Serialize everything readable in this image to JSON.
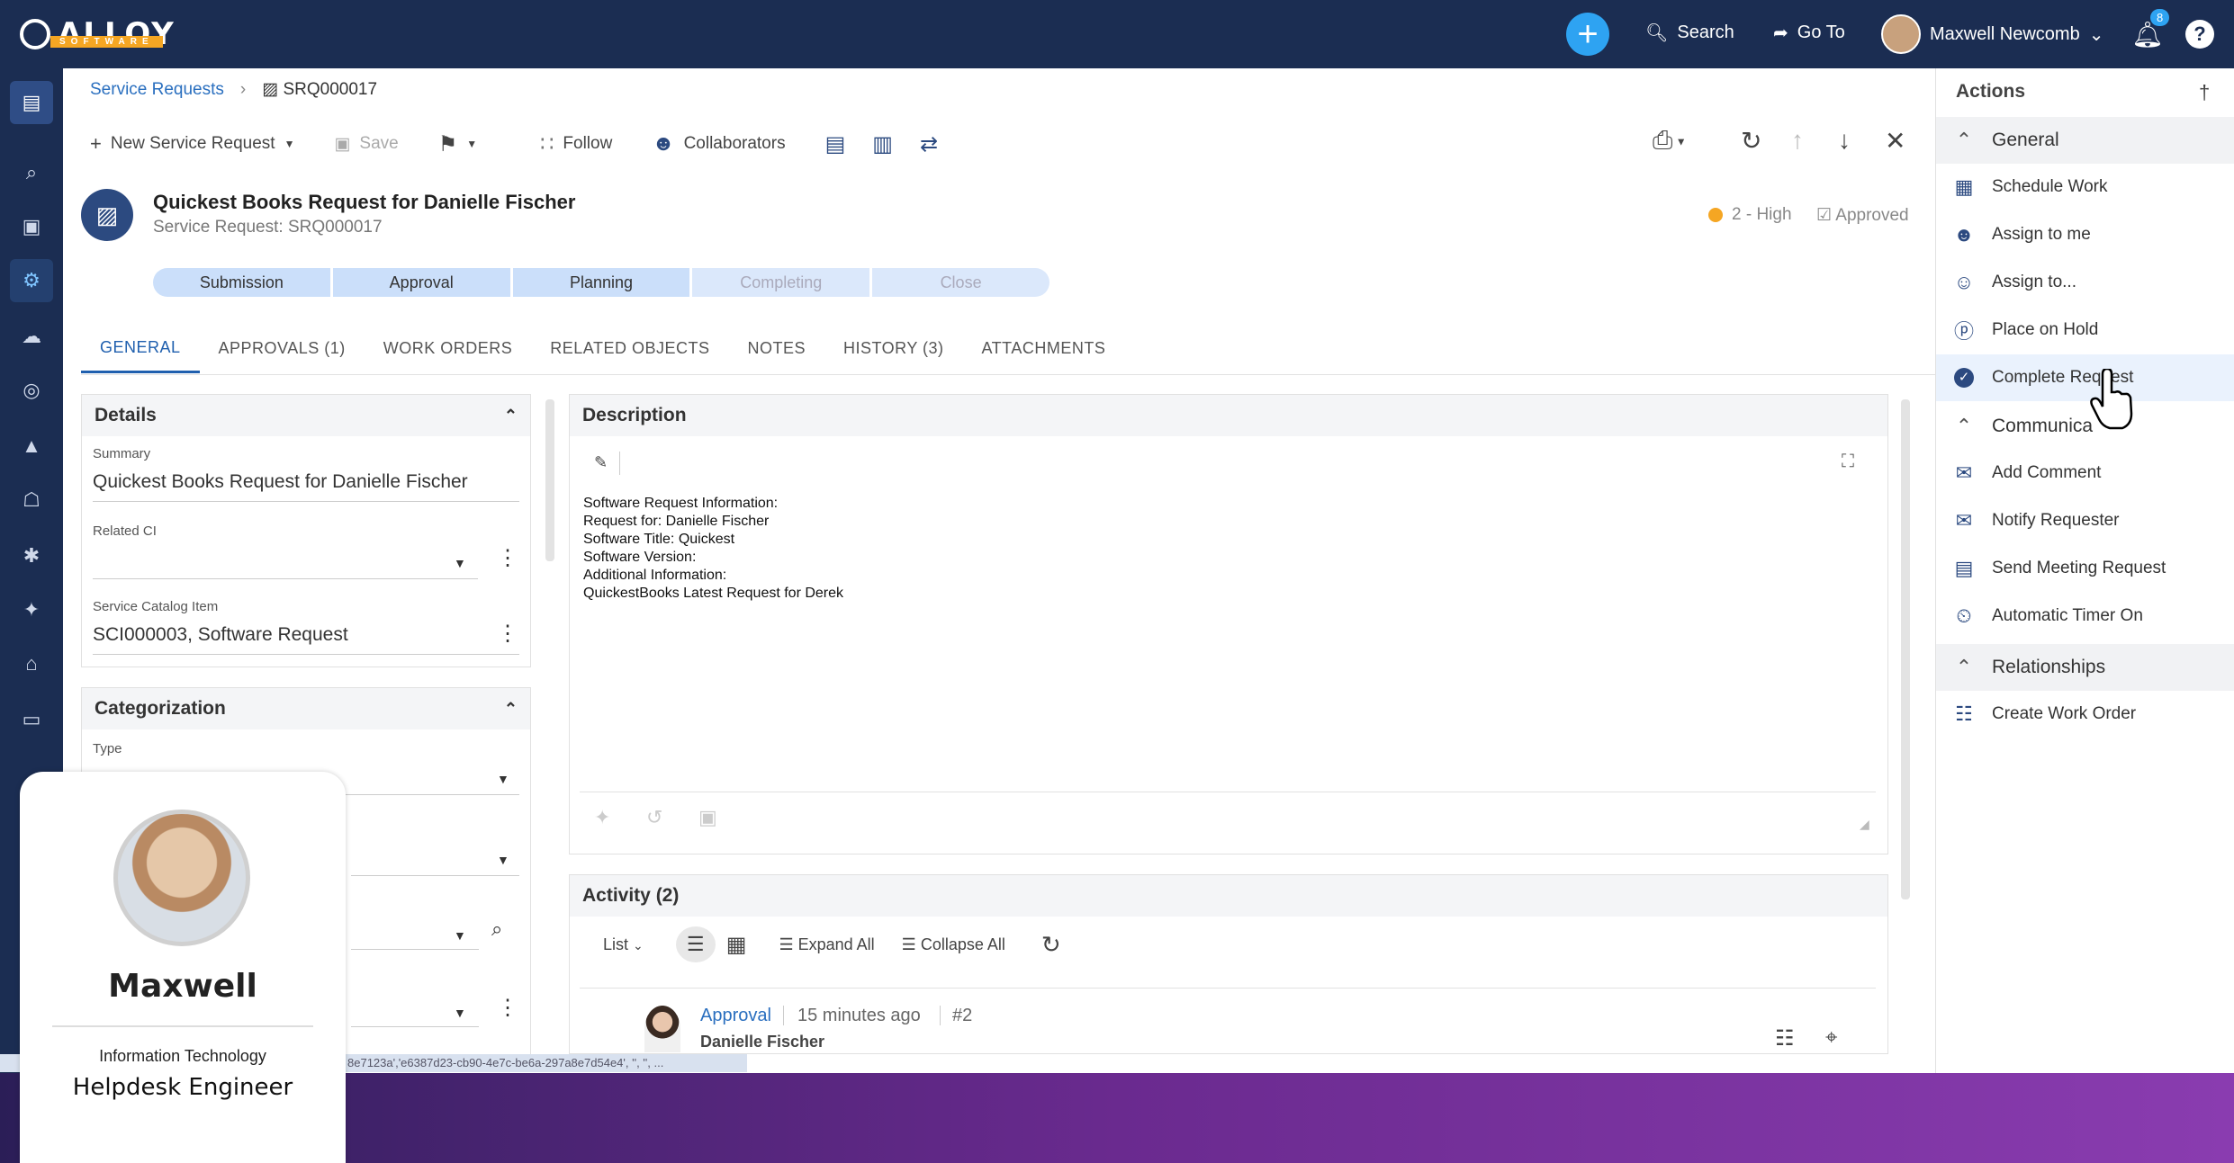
{
  "app": {
    "logo_text": "ALLOY",
    "logo_sub": "SOFTWARE"
  },
  "topbar": {
    "search_label": "Search",
    "goto_label": "Go To",
    "user_name": "Maxwell Newcomb",
    "notifications_count": "8"
  },
  "breadcrumb": {
    "parent": "Service Requests",
    "current": "SRQ000017"
  },
  "toolbar": {
    "new_label": "New Service Request",
    "save_label": "Save",
    "follow_label": "Follow",
    "collaborators_label": "Collaborators"
  },
  "record": {
    "title": "Quickest Books Request for Danielle Fischer",
    "subtitle": "Service Request: SRQ000017",
    "priority": "2 - High",
    "status": "Approved"
  },
  "stepper": {
    "steps": [
      "Submission",
      "Approval",
      "Planning",
      "Completing",
      "Close"
    ]
  },
  "tabs": [
    "GENERAL",
    "APPROVALS (1)",
    "WORK ORDERS",
    "RELATED OBJECTS",
    "NOTES",
    "HISTORY (3)",
    "ATTACHMENTS"
  ],
  "details": {
    "heading": "Details",
    "summary_label": "Summary",
    "summary_value": "Quickest Books  Request for Danielle Fischer",
    "related_ci_label": "Related CI",
    "catalog_label": "Service Catalog Item",
    "catalog_value": "SCI000003, Software Request"
  },
  "categorization": {
    "heading": "Categorization",
    "type_label": "Type"
  },
  "description": {
    "heading": "Description",
    "lines": [
      "Software Request Information:",
      "Request for: Danielle Fischer",
      "Software Title: Quickest",
      "Software Version:",
      "Additional Information:",
      "QuickestBooks Latest Request for Derek"
    ]
  },
  "activity": {
    "heading": "Activity (2)",
    "view_label": "List",
    "expand_label": "Expand All",
    "collapse_label": "Collapse All",
    "entry": {
      "type": "Approval",
      "time": "15 minutes ago",
      "number": "#2",
      "author": "Danielle Fischer"
    }
  },
  "actions": {
    "heading": "Actions",
    "sections": [
      {
        "title": "General",
        "items": [
          "Schedule Work",
          "Assign to me",
          "Assign to...",
          "Place on Hold",
          "Complete Request"
        ]
      },
      {
        "title": "Communica",
        "items": [
          "Add Comment",
          "Notify Requester",
          "Send Meeting Request",
          "Automatic Timer On"
        ]
      },
      {
        "title": "Relationships",
        "items": [
          "Create Work Order"
        ]
      }
    ]
  },
  "statusbar": {
    "text": "8e7123a','e6387d23-cb90-4e7c-be6a-297a8e7d54e4', '', '', ..."
  },
  "profile": {
    "name": "Maxwell",
    "department": "Information Technology",
    "role": "Helpdesk Engineer"
  },
  "colors": {
    "nav_bg": "#1b2d52",
    "accent": "#2ea3f2",
    "priority_dot": "#f5a623",
    "link": "#2a6fbf"
  }
}
